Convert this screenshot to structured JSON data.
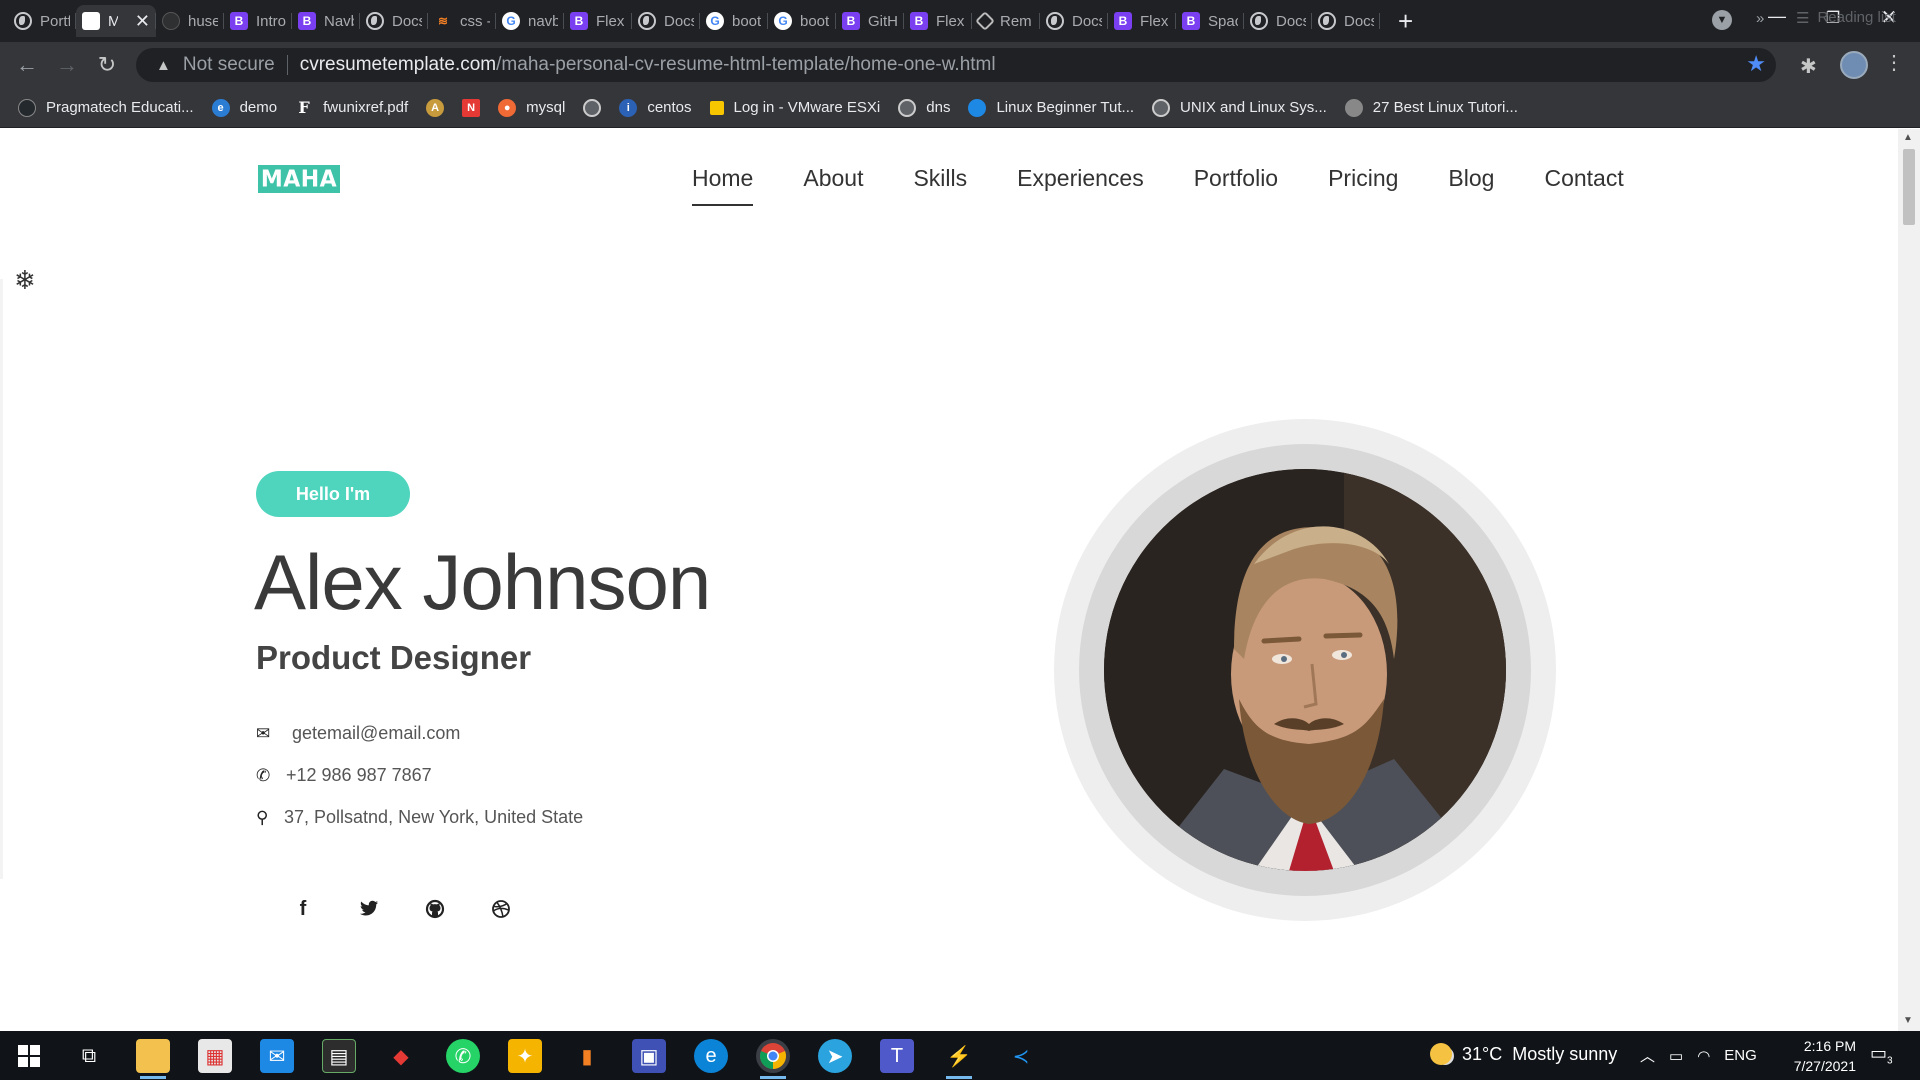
{
  "browser": {
    "tabs": [
      {
        "label": "Portfolio",
        "icon": "globe",
        "active": false
      },
      {
        "label": "MAHA",
        "icon": "blank",
        "active": true
      },
      {
        "label": "huseyin",
        "icon": "dark",
        "active": false
      },
      {
        "label": "Introduction",
        "icon": "bootstrap",
        "active": false
      },
      {
        "label": "Navbar",
        "icon": "bootstrap",
        "active": false
      },
      {
        "label": "Docs",
        "icon": "globe",
        "active": false
      },
      {
        "label": "css -",
        "icon": "stackoverflow",
        "active": false
      },
      {
        "label": "navbar",
        "icon": "google",
        "active": false
      },
      {
        "label": "Flex",
        "icon": "bootstrap",
        "active": false
      },
      {
        "label": "Docs",
        "icon": "globe",
        "active": false
      },
      {
        "label": "boot",
        "icon": "google",
        "active": false
      },
      {
        "label": "boot",
        "icon": "google",
        "active": false
      },
      {
        "label": "GitHub",
        "icon": "bootstrap",
        "active": false
      },
      {
        "label": "Flex",
        "icon": "bootstrap",
        "active": false
      },
      {
        "label": "Rem",
        "icon": "rem",
        "active": false
      },
      {
        "label": "Docs",
        "icon": "globe",
        "active": false
      },
      {
        "label": "Flex",
        "icon": "bootstrap",
        "active": false
      },
      {
        "label": "Spacing",
        "icon": "bootstrap",
        "active": false
      },
      {
        "label": "Docs",
        "icon": "globe",
        "active": false
      },
      {
        "label": "Docs",
        "icon": "globe",
        "active": false
      }
    ],
    "security_label": "Not secure",
    "url_host": "cvresumetemplate.com",
    "url_path": "/maha-personal-cv-resume-html-template/home-one-w.html",
    "bookmarks": [
      {
        "label": "Pragmatech Educati...",
        "icon": "github-icon",
        "color": "#24292e"
      },
      {
        "label": "demo",
        "icon": "edge-icon",
        "color": "#2b7cd3"
      },
      {
        "label": "fwunixref.pdf",
        "icon": "pdf-icon",
        "color": "#35363a"
      },
      {
        "label": "",
        "icon": "arch-icon",
        "color": "#c89b3c"
      },
      {
        "label": "",
        "icon": "news-icon",
        "color": "#e53935"
      },
      {
        "label": "mysql",
        "icon": "mysql-icon",
        "color": "#f06a35"
      },
      {
        "label": "",
        "icon": "globe-icon",
        "color": "#5f6368"
      },
      {
        "label": "centos",
        "icon": "centos-icon",
        "color": "#2c62b5"
      },
      {
        "label": "Log in - VMware ESXi",
        "icon": "vmware-icon",
        "color": "#f7c600"
      },
      {
        "label": "dns",
        "icon": "globe-icon",
        "color": "#5f6368"
      },
      {
        "label": "Linux Beginner Tut...",
        "icon": "world-icon",
        "color": "#1e88e5"
      },
      {
        "label": "UNIX and Linux Sys...",
        "icon": "globe-icon",
        "color": "#5f6368"
      },
      {
        "label": "27 Best Linux Tutori...",
        "icon": "linux-icon",
        "color": "#888888"
      }
    ],
    "more_bookmarks": "»",
    "reading_list": "Reading list"
  },
  "site": {
    "logo": "MAHA",
    "nav": [
      "Home",
      "About",
      "Skills",
      "Experiences",
      "Portfolio",
      "Pricing",
      "Blog",
      "Contact"
    ],
    "active_nav": "Home",
    "accent": "#4fd4bd",
    "hero": {
      "greeting": "Hello I'm",
      "name": "Alex Johnson",
      "role": "Product Designer",
      "email": "getemail@email.com",
      "phone": "+12 986 987 7867",
      "address": "37, Pollsatnd, New York, United State"
    },
    "socials": [
      "facebook-icon",
      "twitter-icon",
      "github-icon",
      "dribbble-icon"
    ]
  },
  "taskbar": {
    "weather_temp": "31°C",
    "weather_text": "Mostly sunny",
    "language": "ENG",
    "time": "2:16 PM",
    "date": "7/27/2021",
    "notifications": "3"
  }
}
